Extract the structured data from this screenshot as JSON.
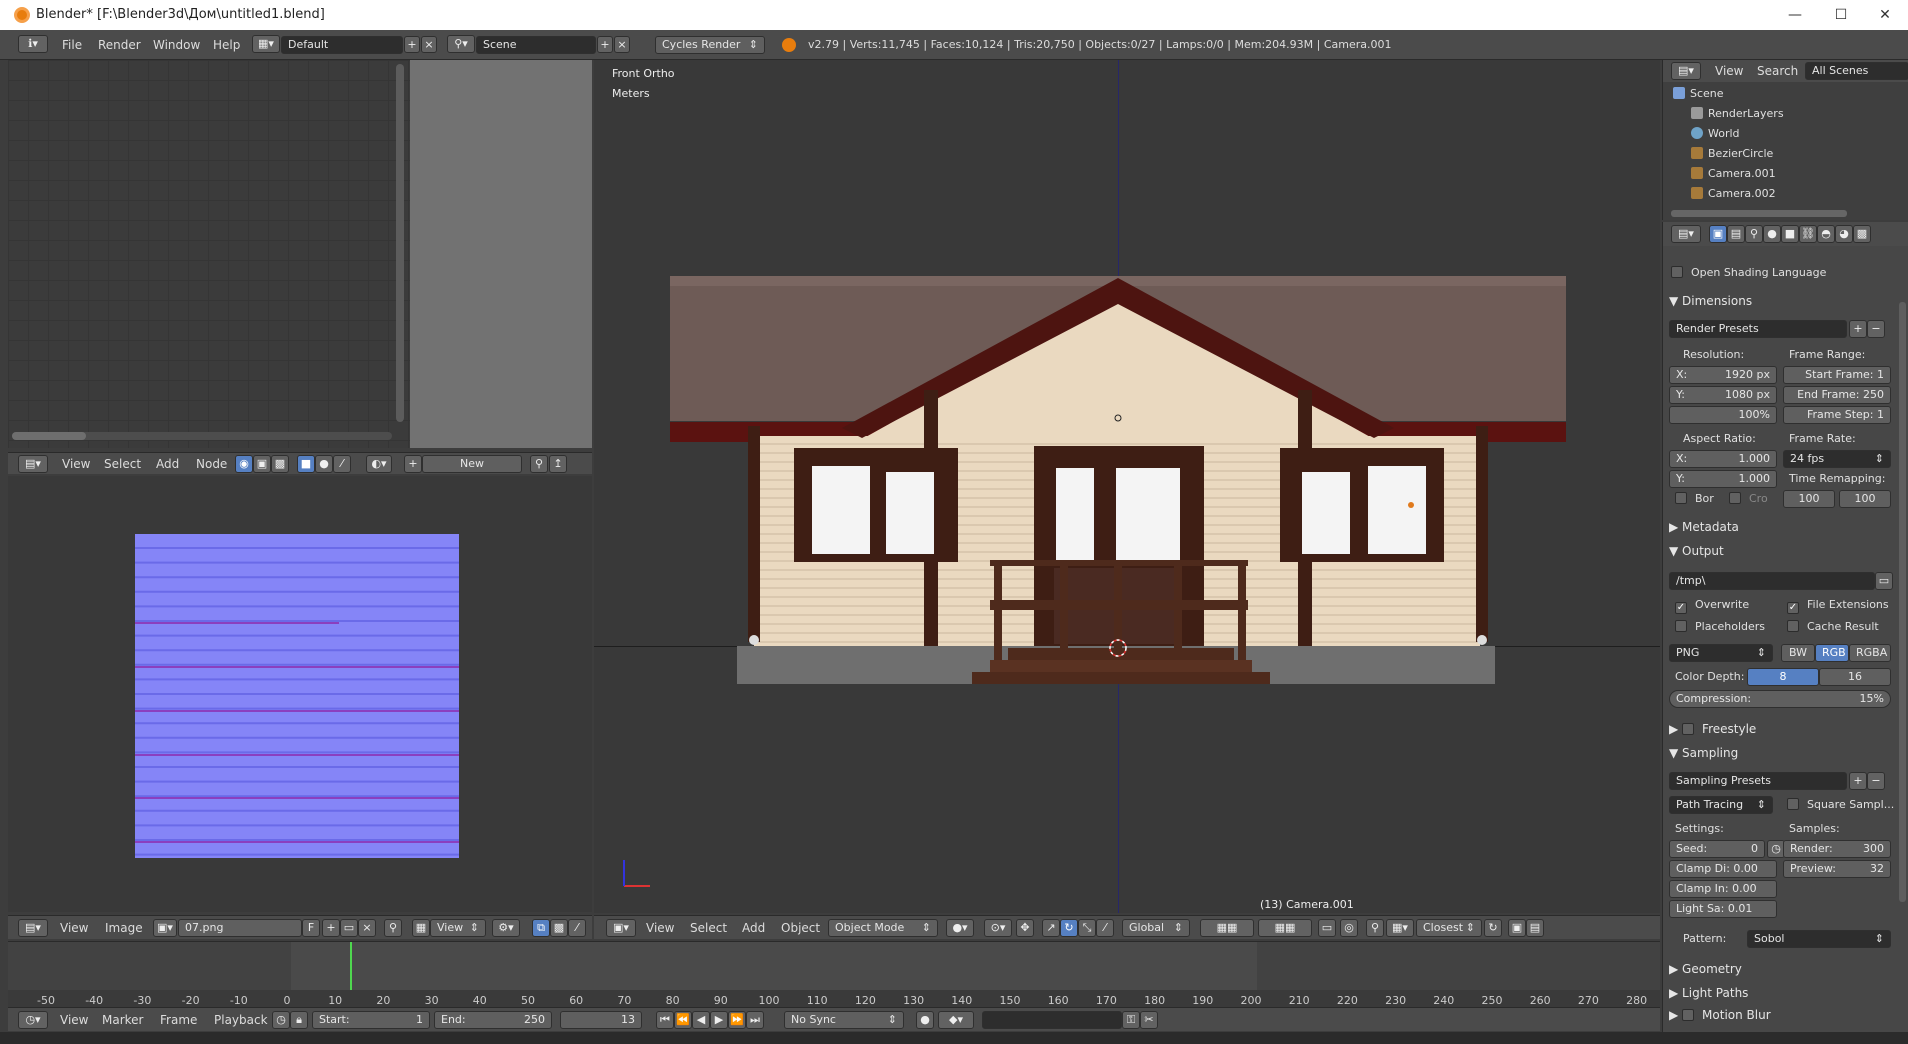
{
  "window": {
    "title": "Blender* [F:\\Blender3d\\Дом\\untitled1.blend]",
    "min": "—",
    "max": "☐",
    "close": "✕"
  },
  "info_header": {
    "menus": [
      "File",
      "Render",
      "Window",
      "Help"
    ],
    "layout": "Default",
    "scene": "Scene",
    "engine": "Cycles Render",
    "stats": "v2.79 | Verts:11,745 | Faces:10,124 | Tris:20,750 | Objects:0/27 | Lamps:0/0 | Mem:204.93M | Camera.001"
  },
  "node_header": {
    "menus": [
      "View",
      "Select",
      "Add",
      "Node"
    ],
    "new_label": "New"
  },
  "image_header": {
    "menus": [
      "View",
      "Image"
    ],
    "image_name": "07.png",
    "fake_user": "F",
    "view_label": "View"
  },
  "viewport": {
    "view_name": "Front Ortho",
    "units": "Meters",
    "object_label": "(13) Camera.001",
    "menus": [
      "View",
      "Select",
      "Add",
      "Object"
    ],
    "mode": "Object Mode",
    "orientation": "Global",
    "snap": "Closest",
    "colors": {
      "bg": "#393939",
      "siding": "#ead9c0",
      "trim": "#3e1e14",
      "roof": "#6e5b56",
      "glass": "#f4f4f4",
      "foundation": "#6f6f6f",
      "porch": "#4e2a1c"
    }
  },
  "timeline": {
    "ticks": [
      "-50",
      "-40",
      "-30",
      "-20",
      "-10",
      "0",
      "10",
      "20",
      "30",
      "40",
      "50",
      "60",
      "70",
      "80",
      "90",
      "100",
      "110",
      "120",
      "130",
      "140",
      "150",
      "160",
      "170",
      "180",
      "190",
      "200",
      "210",
      "220",
      "230",
      "240",
      "250",
      "260",
      "270",
      "280"
    ],
    "menus": [
      "View",
      "Marker",
      "Frame",
      "Playback"
    ],
    "start_label": "Start:",
    "start": "1",
    "end_label": "End:",
    "end": "250",
    "current": "13",
    "sync": "No Sync"
  },
  "outliner": {
    "menus": [
      "View",
      "Search"
    ],
    "filter": "All Scenes",
    "items": [
      "Scene",
      "RenderLayers",
      "World",
      "BezierCircle",
      "Camera.001",
      "Camera.002"
    ]
  },
  "properties": {
    "osl": "Open Shading Language",
    "dimensions": {
      "title": "Dimensions",
      "presets": "Render Presets",
      "resolution_label": "Resolution:",
      "res_x_label": "X:",
      "res_x": "1920 px",
      "res_y_label": "Y:",
      "res_y": "1080 px",
      "res_pct": "100%",
      "frame_range_label": "Frame Range:",
      "start_frame": "Start Frame: 1",
      "end_frame": "End Frame: 250",
      "frame_step": "Frame Step: 1",
      "aspect_label": "Aspect Ratio:",
      "asp_x_label": "X:",
      "asp_x": "1.000",
      "asp_y_label": "Y:",
      "asp_y": "1.000",
      "frame_rate_label": "Frame Rate:",
      "fps": "24 fps",
      "bor": "Bor",
      "cro": "Cro",
      "time_remap_label": "Time Remapping:",
      "remap_old": "100",
      "remap_new": "100"
    },
    "metadata": "Metadata",
    "output": {
      "title": "Output",
      "path": "/tmp\\",
      "overwrite": "Overwrite",
      "file_ext": "File Extensions",
      "placeholders": "Placeholders",
      "cache_result": "Cache Result",
      "format": "PNG",
      "bw": "BW",
      "rgb": "RGB",
      "rgba": "RGBA",
      "color_depth_label": "Color Depth:",
      "depth_8": "8",
      "depth_16": "16",
      "compression_label": "Compression:",
      "compression": "15%"
    },
    "freestyle": "Freestyle",
    "sampling": {
      "title": "Sampling",
      "presets": "Sampling Presets",
      "method": "Path Tracing",
      "square": "Square Sampl...",
      "settings_label": "Settings:",
      "samples_label": "Samples:",
      "seed_label": "Seed:",
      "seed": "0",
      "render_label": "Render:",
      "render": "300",
      "clamp_di": "Clamp Di: 0.00",
      "preview_label": "Preview:",
      "preview": "32",
      "clamp_in": "Clamp In: 0.00",
      "light_sa": "Light Sa:  0.01",
      "pattern_label": "Pattern:",
      "pattern": "Sobol"
    },
    "geometry": "Geometry",
    "light_paths": "Light Paths",
    "motion_blur": "Motion Blur"
  }
}
